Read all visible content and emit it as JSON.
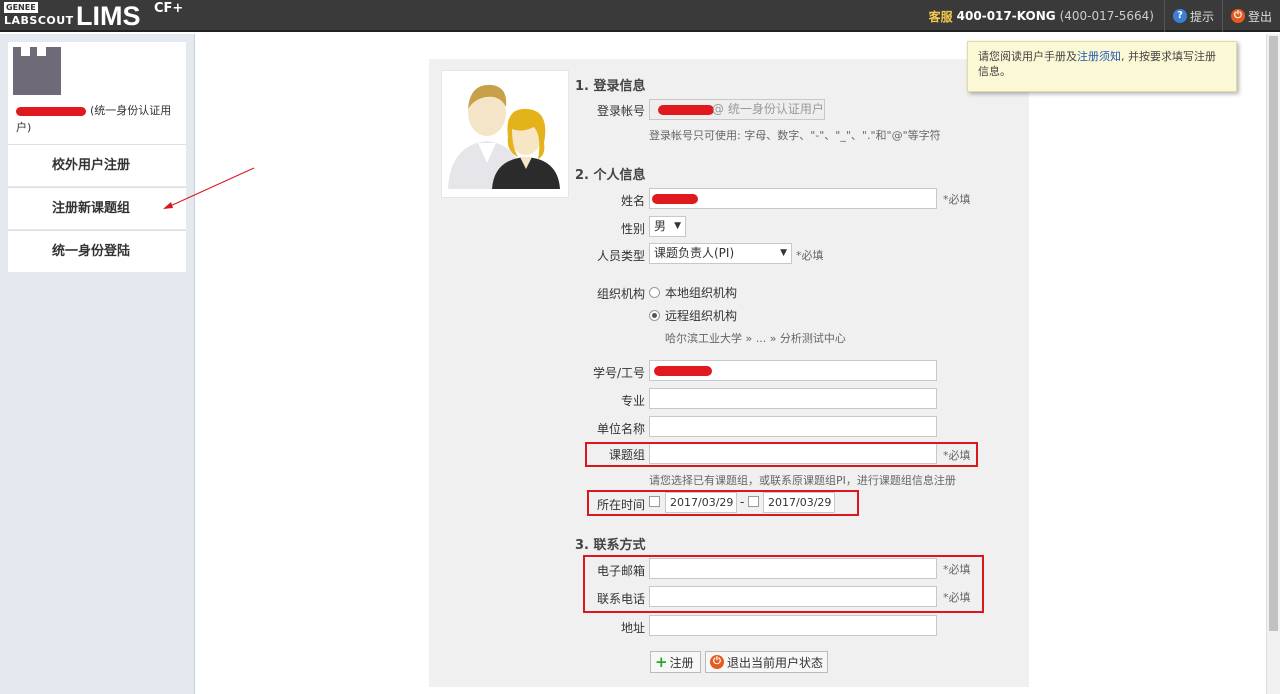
{
  "header": {
    "logo_genee": "GENEE",
    "logo_labscout": "LABSCOUT",
    "logo_lims": "LIMS",
    "logo_cf": "CF+",
    "hotline_label": "客服",
    "hotline_number": "400-017-KONG",
    "hotline_digits": "(400-017-5664)",
    "hint_label": "提示",
    "logout_label": "登出"
  },
  "sidebar": {
    "user_suffix": "(统一身份认证用户)",
    "items": [
      {
        "label": "校外用户注册"
      },
      {
        "label": "注册新课题组"
      },
      {
        "label": "统一身份登陆"
      }
    ]
  },
  "tooltip": {
    "text_before": "请您阅读用户手册及",
    "link": "注册须知",
    "text_after": ", 并按要求填写注册信息。"
  },
  "form": {
    "section1_title": "1. 登录信息",
    "account_label": "登录帐号",
    "account_suffix": "@ 统一身份认证用户",
    "account_hint": "登录帐号只可使用: 字母、数字、\"-\"、\"_\"、\".\"和\"@\"等字符",
    "section2_title": "2. 个人信息",
    "name_label": "姓名",
    "required": "*必填",
    "gender_label": "性别",
    "gender_value": "男",
    "person_type_label": "人员类型",
    "person_type_value": "课题负责人(PI)",
    "org_label": "组织机构",
    "org_local": "本地组织机构",
    "org_remote": "远程组织机构",
    "org_path": "哈尔滨工业大学 » ... » 分析测试中心",
    "student_id_label": "学号/工号",
    "major_label": "专业",
    "unit_label": "单位名称",
    "group_label": "课题组",
    "group_hint": "请您选择已有课题组，或联系原课题组PI，进行课题组信息注册",
    "time_label": "所在时间",
    "date_start": "2017/03/29",
    "date_sep": "-",
    "date_end": "2017/03/29",
    "section3_title": "3. 联系方式",
    "email_label": "电子邮箱",
    "phone_label": "联系电话",
    "address_label": "地址",
    "register_button": "注册",
    "logout_button": "退出当前用户状态"
  },
  "colors": {
    "topbar": "#3a3a3a",
    "sidebar": "#e4e9f0",
    "highlight_red": "#d9181e",
    "tooltip_bg": "#fbf8d6"
  }
}
